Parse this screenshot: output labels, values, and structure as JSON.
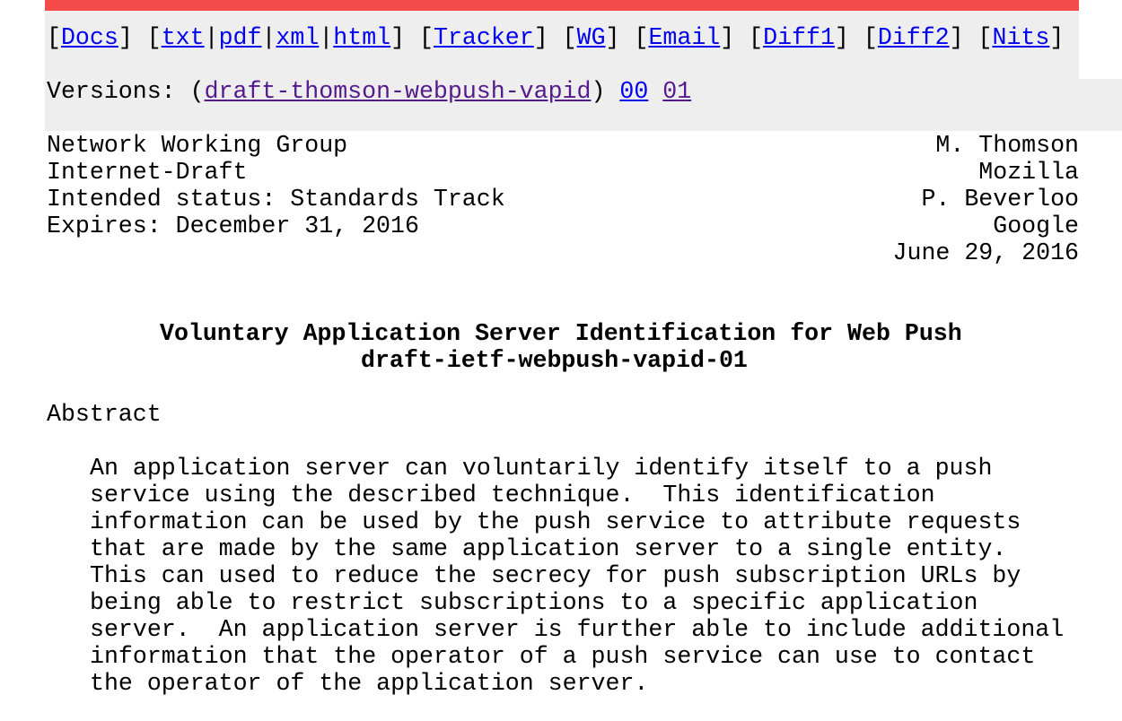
{
  "nav": {
    "links": [
      {
        "label": "Docs"
      },
      {
        "label": "txt"
      },
      {
        "label": "pdf"
      },
      {
        "label": "xml"
      },
      {
        "label": "html"
      },
      {
        "label": "Tracker"
      },
      {
        "label": "WG"
      },
      {
        "label": "Email"
      },
      {
        "label": "Diff1"
      },
      {
        "label": "Diff2"
      },
      {
        "label": "Nits"
      }
    ]
  },
  "versions": {
    "prefix": "Versions: (",
    "draft_name": "draft-thomson-webpush-vapid",
    "suffix": ")",
    "v00": "00",
    "v01": "01"
  },
  "header": {
    "left": [
      "Network Working Group",
      "Internet-Draft",
      "Intended status: Standards Track",
      "Expires: December 31, 2016"
    ],
    "right": [
      "M. Thomson",
      "Mozilla",
      "P. Beverloo",
      "Google",
      "June 29, 2016"
    ]
  },
  "title": {
    "line1": "Voluntary Application Server Identification for Web Push",
    "line2": "draft-ietf-webpush-vapid-01"
  },
  "abstract": {
    "heading": "Abstract",
    "lines": [
      "An application server can voluntarily identify itself to a push",
      "service using the described technique.  This identification",
      "information can be used by the push service to attribute requests",
      "that are made by the same application server to a single entity.",
      "This can used to reduce the secrecy for push subscription URLs by",
      "being able to restrict subscriptions to a specific application",
      "server.  An application server is further able to include additional",
      "information that the operator of a push service can use to contact",
      "the operator of the application server."
    ]
  },
  "colors": {
    "accent_bar": "#f44a4a",
    "nav_background": "#eeeeee",
    "link": "#0000ee",
    "visited_link": "#551a8b"
  }
}
